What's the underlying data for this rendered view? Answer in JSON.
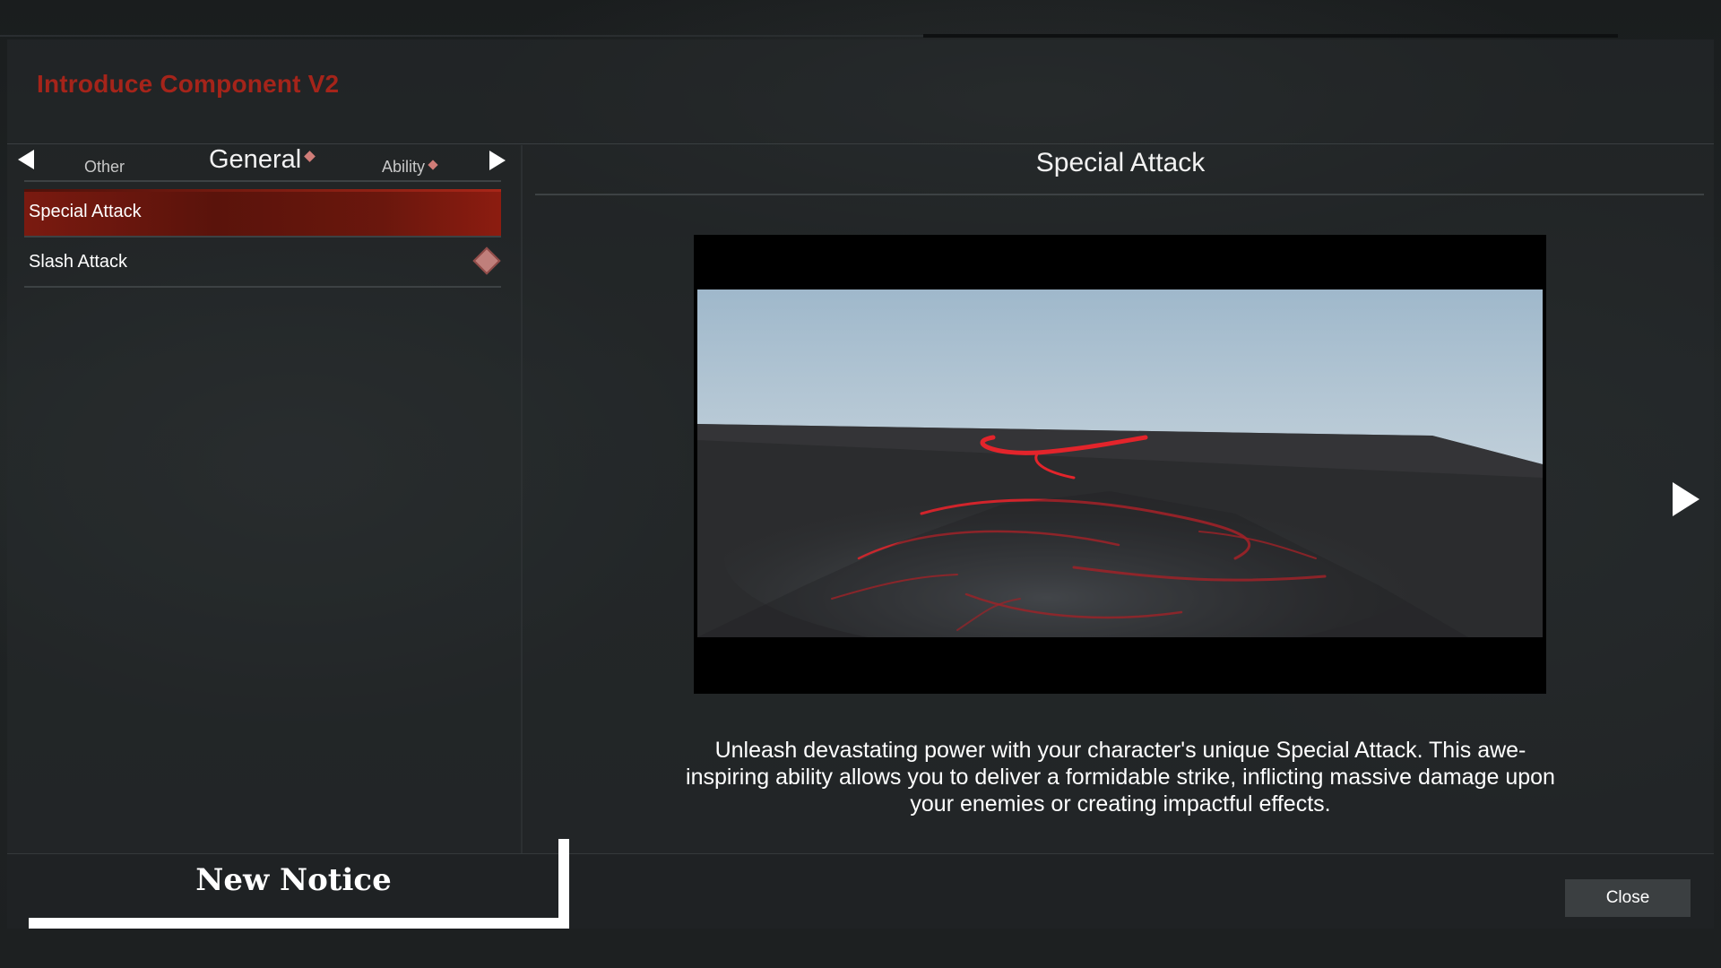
{
  "window": {
    "title": "Introduce Component V2",
    "title_color": "#a5241a"
  },
  "tabs": {
    "prev_icon": "triangle-left-icon",
    "next_icon": "triangle-right-icon",
    "items": [
      {
        "label": "Other",
        "has_new": false
      },
      {
        "label": "General",
        "has_new": true,
        "active": true
      },
      {
        "label": "Ability",
        "has_new": true
      }
    ]
  },
  "list": {
    "items": [
      {
        "label": "Special Attack",
        "selected": true,
        "has_new": false
      },
      {
        "label": "Slash Attack",
        "selected": false,
        "has_new": true
      }
    ],
    "selected_color": "#7a1a10",
    "new_badge_color": "#c07f7b"
  },
  "content": {
    "title": "Special Attack",
    "video_icon": "video-preview",
    "description": "Unleash devastating power with your character's unique Special Attack. This awe-inspiring ability allows you to deliver a formidable strike, inflicting massive damage upon your enemies or creating impactful effects.",
    "next_page_icon": "triangle-right-icon"
  },
  "footer": {
    "notice_label": "New Notice",
    "close_label": "Close"
  }
}
